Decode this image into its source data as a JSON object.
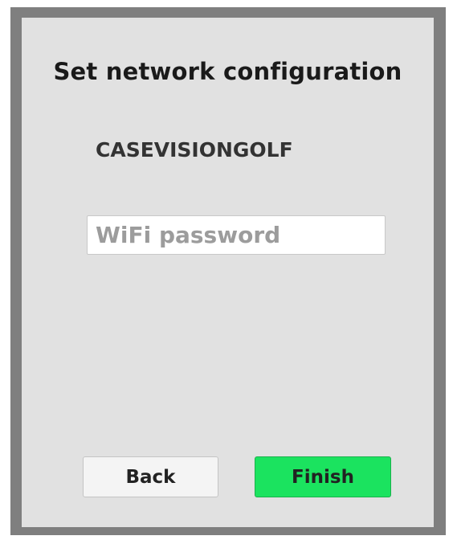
{
  "dialog": {
    "title": "Set network configuration",
    "network_name": "CASEVISIONGOLF"
  },
  "password": {
    "placeholder": "WiFi password",
    "value": ""
  },
  "buttons": {
    "back_label": "Back",
    "finish_label": "Finish"
  },
  "colors": {
    "panel_border": "#7f7f7f",
    "panel_background": "#e1e1e1",
    "finish_button": "#1be35f",
    "back_button": "#f4f4f4"
  }
}
